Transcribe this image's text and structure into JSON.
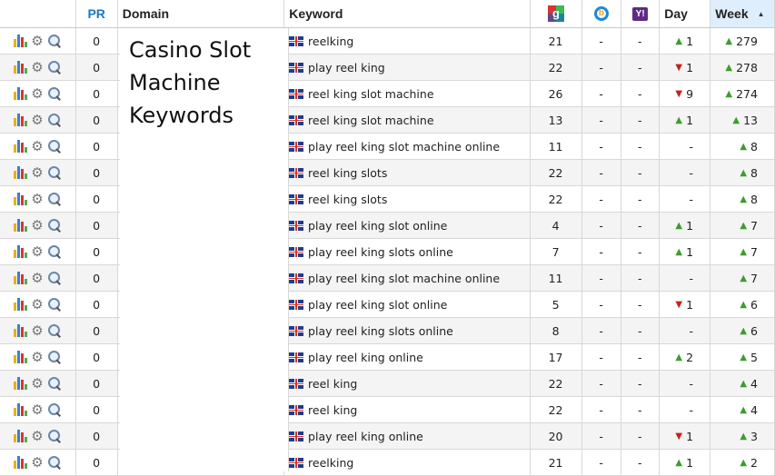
{
  "header": {
    "pr": "PR",
    "domain": "Domain",
    "keyword": "Keyword",
    "google_icon": "google-icon",
    "bing_icon": "bing-icon",
    "yahoo_icon": "yahoo-icon",
    "day": "Day",
    "week": "Week",
    "sort_indicator": "▲"
  },
  "domain_text": "Casino Slot Machine Keywords",
  "colors": {
    "up": "#3f9b2f",
    "down": "#c8201b",
    "sorted_header": "#dfeefc",
    "pr_header": "#1a78c2"
  },
  "rows": [
    {
      "pr": "0",
      "keyword": "reelking",
      "google": "21",
      "bing": "-",
      "yahoo": "-",
      "day_dir": "up",
      "day": "1",
      "week_dir": "up",
      "week": "279"
    },
    {
      "pr": "0",
      "keyword": "play reel king",
      "google": "22",
      "bing": "-",
      "yahoo": "-",
      "day_dir": "down",
      "day": "1",
      "week_dir": "up",
      "week": "278"
    },
    {
      "pr": "0",
      "keyword": "reel king slot machine",
      "google": "26",
      "bing": "-",
      "yahoo": "-",
      "day_dir": "down",
      "day": "9",
      "week_dir": "up",
      "week": "274"
    },
    {
      "pr": "0",
      "keyword": "reel king slot machine",
      "google": "13",
      "bing": "-",
      "yahoo": "-",
      "day_dir": "up",
      "day": "1",
      "week_dir": "up",
      "week": "13"
    },
    {
      "pr": "0",
      "keyword": "play reel king slot machine online",
      "google": "11",
      "bing": "-",
      "yahoo": "-",
      "day_dir": "none",
      "day": "-",
      "week_dir": "up",
      "week": "8"
    },
    {
      "pr": "0",
      "keyword": "reel king slots",
      "google": "22",
      "bing": "-",
      "yahoo": "-",
      "day_dir": "none",
      "day": "-",
      "week_dir": "up",
      "week": "8"
    },
    {
      "pr": "0",
      "keyword": "reel king slots",
      "google": "22",
      "bing": "-",
      "yahoo": "-",
      "day_dir": "none",
      "day": "-",
      "week_dir": "up",
      "week": "8"
    },
    {
      "pr": "0",
      "keyword": "play reel king slot online",
      "google": "4",
      "bing": "-",
      "yahoo": "-",
      "day_dir": "up",
      "day": "1",
      "week_dir": "up",
      "week": "7"
    },
    {
      "pr": "0",
      "keyword": "play reel king slots online",
      "google": "7",
      "bing": "-",
      "yahoo": "-",
      "day_dir": "up",
      "day": "1",
      "week_dir": "up",
      "week": "7"
    },
    {
      "pr": "0",
      "keyword": "play reel king slot machine online",
      "google": "11",
      "bing": "-",
      "yahoo": "-",
      "day_dir": "none",
      "day": "-",
      "week_dir": "up",
      "week": "7"
    },
    {
      "pr": "0",
      "keyword": "play reel king slot online",
      "google": "5",
      "bing": "-",
      "yahoo": "-",
      "day_dir": "down",
      "day": "1",
      "week_dir": "up",
      "week": "6"
    },
    {
      "pr": "0",
      "keyword": "play reel king slots online",
      "google": "8",
      "bing": "-",
      "yahoo": "-",
      "day_dir": "none",
      "day": "-",
      "week_dir": "up",
      "week": "6"
    },
    {
      "pr": "0",
      "keyword": "play reel king online",
      "google": "17",
      "bing": "-",
      "yahoo": "-",
      "day_dir": "up",
      "day": "2",
      "week_dir": "up",
      "week": "5"
    },
    {
      "pr": "0",
      "keyword": "reel king",
      "google": "22",
      "bing": "-",
      "yahoo": "-",
      "day_dir": "none",
      "day": "-",
      "week_dir": "up",
      "week": "4"
    },
    {
      "pr": "0",
      "keyword": "reel king",
      "google": "22",
      "bing": "-",
      "yahoo": "-",
      "day_dir": "none",
      "day": "-",
      "week_dir": "up",
      "week": "4"
    },
    {
      "pr": "0",
      "keyword": "play reel king online",
      "google": "20",
      "bing": "-",
      "yahoo": "-",
      "day_dir": "down",
      "day": "1",
      "week_dir": "up",
      "week": "3"
    },
    {
      "pr": "0",
      "keyword": "reelking",
      "google": "21",
      "bing": "-",
      "yahoo": "-",
      "day_dir": "up",
      "day": "1",
      "week_dir": "up",
      "week": "2"
    }
  ]
}
